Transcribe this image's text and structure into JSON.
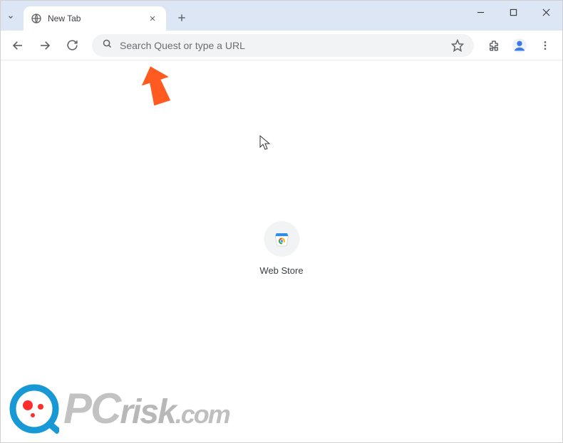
{
  "tab": {
    "title": "New Tab"
  },
  "omnibox": {
    "placeholder": "Search Quest or type a URL",
    "value": ""
  },
  "shortcuts": [
    {
      "label": "Web Store"
    }
  ],
  "watermark": {
    "pc": "PC",
    "risk": "risk",
    "com": ".com"
  },
  "icons": {
    "close": "✕",
    "plus": "+",
    "menu": "⋮"
  }
}
